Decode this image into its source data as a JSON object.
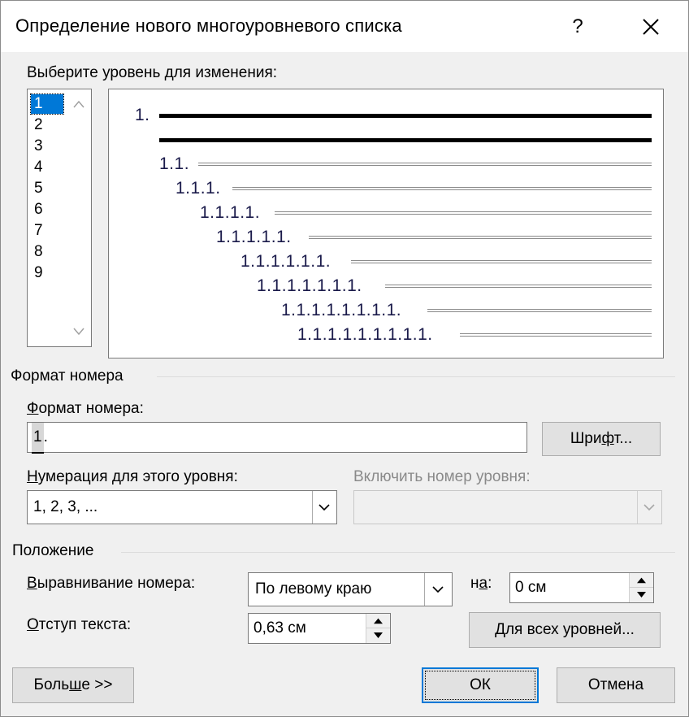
{
  "dialog": {
    "title": "Определение нового многоуровневого списка",
    "help_label": "?"
  },
  "level_section": {
    "label": "Выберите уровень для изменения:",
    "levels": [
      "1",
      "2",
      "3",
      "4",
      "5",
      "6",
      "7",
      "8",
      "9"
    ],
    "selected": "1"
  },
  "preview": {
    "level_numbers": [
      "1.",
      "1.1.",
      "1.1.1.",
      "1.1.1.1.",
      "1.1.1.1.1.",
      "1.1.1.1.1.1.",
      "1.1.1.1.1.1.1.",
      "1.1.1.1.1.1.1.1.",
      "1.1.1.1.1.1.1.1.1."
    ]
  },
  "number_format": {
    "group_title": "Формат номера",
    "format_label": "Формат номера:",
    "format_value_selected": "1",
    "format_value_rest": ".",
    "font_button": "Шрифт...",
    "numbering_label": "Нумерация для этого уровня:",
    "numbering_value": "1, 2, 3, ...",
    "include_label": "Включить номер уровня:",
    "include_value": ""
  },
  "position": {
    "group_title": "Положение",
    "alignment_label": "Выравнивание номера:",
    "alignment_value": "По левому краю",
    "at_label": "на:",
    "at_value": "0 см",
    "indent_label": "Отступ текста:",
    "indent_value": "0,63 см",
    "all_levels_button": "Для всех уровней..."
  },
  "footer": {
    "more_button": "Больше >>",
    "ok_button": "ОК",
    "cancel_button": "Отмена"
  },
  "colors": {
    "selection": "#0078d7",
    "dialog_bg": "#f0f0f0",
    "preview_number": "#1a1a4a"
  }
}
